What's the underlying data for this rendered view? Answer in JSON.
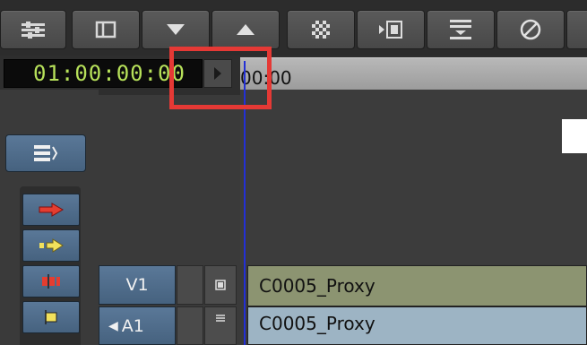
{
  "toolbar": {
    "buttons": [
      {
        "name": "mixer-icon"
      },
      {
        "name": "panel-toggle-icon"
      },
      {
        "name": "arrow-down-icon"
      },
      {
        "name": "arrow-up-icon"
      },
      {
        "name": "checker-fill-icon"
      },
      {
        "name": "insert-frame-icon"
      },
      {
        "name": "lift-extract-icon"
      },
      {
        "name": "disable-icon"
      }
    ]
  },
  "timecode": {
    "value": "01:00:00:00"
  },
  "ruler": {
    "label": "00:00"
  },
  "tracks": {
    "v1_label": "V1",
    "a1_label": "A1",
    "v1_clip": "C0005_Proxy",
    "a1_clip": "C0005_Proxy"
  },
  "colors": {
    "timecode_text": "#b7e15a",
    "playhead": "#2330d6",
    "highlight": "#e53935",
    "video_clip": "#8c9471",
    "audio_clip": "#9db4c4",
    "track_button": "#4f6d8b"
  }
}
